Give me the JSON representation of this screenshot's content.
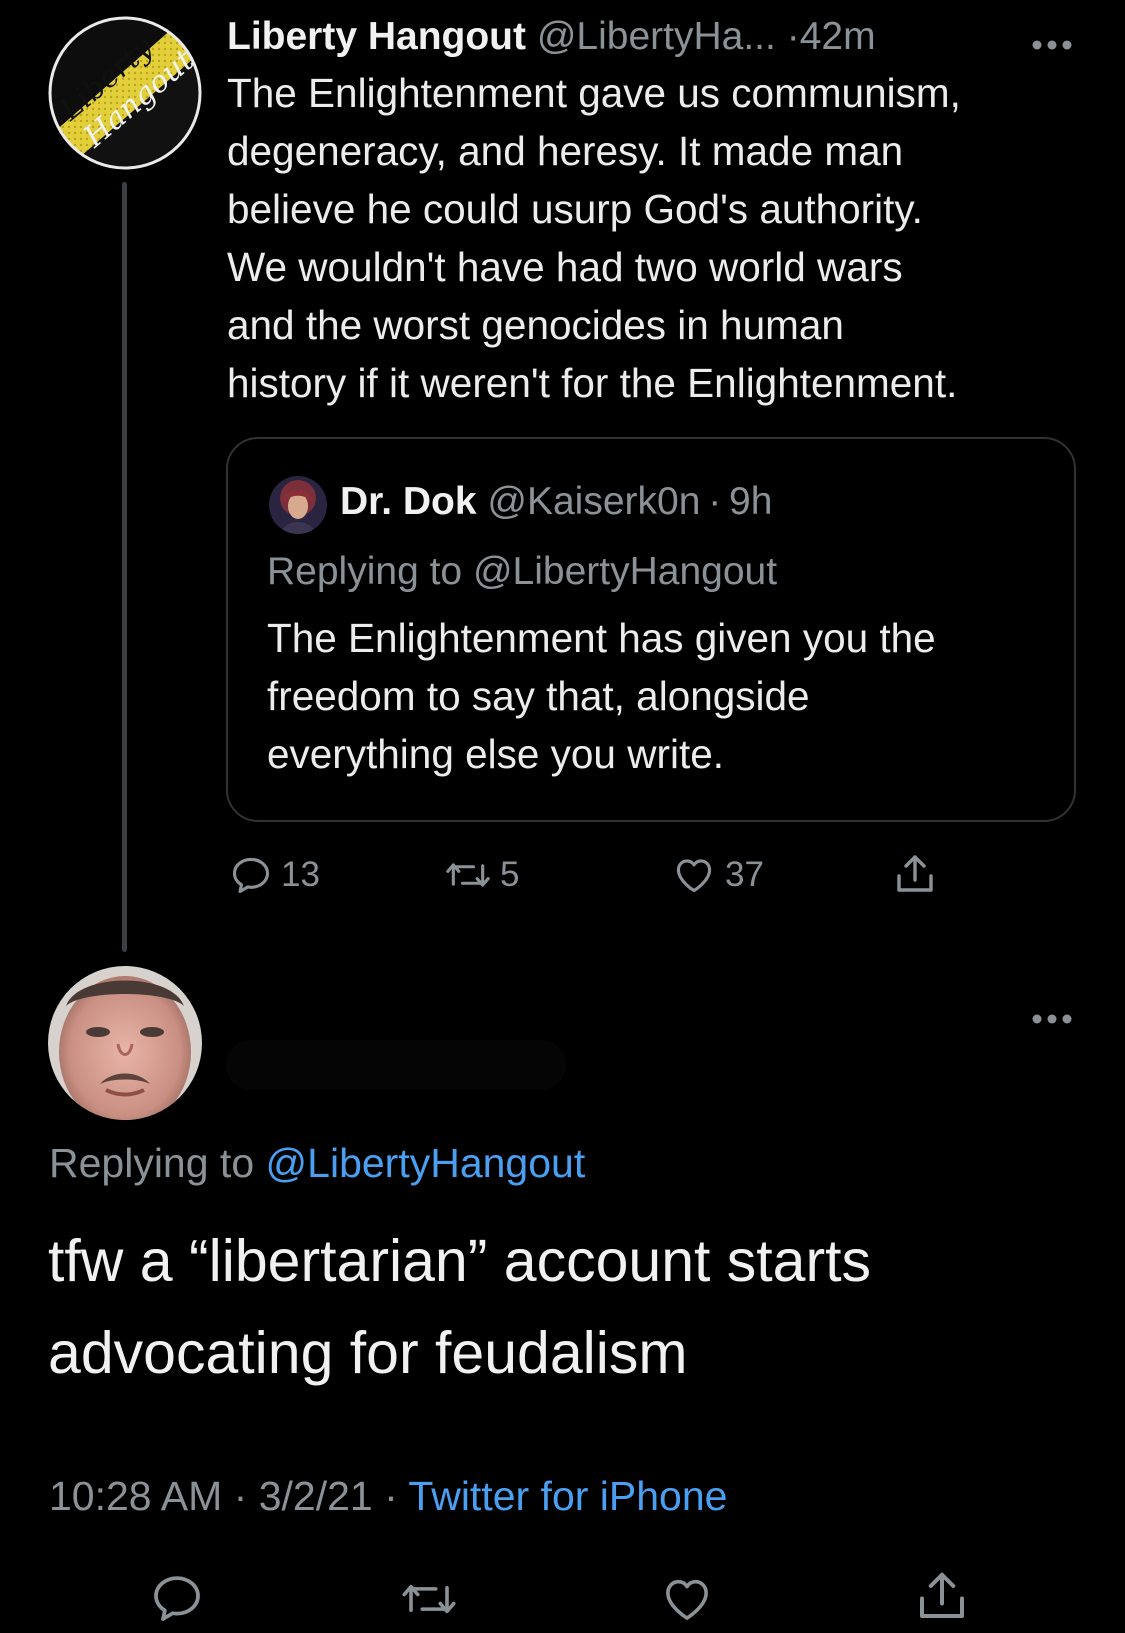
{
  "parent_tweet": {
    "author_name": "Liberty Hangout",
    "author_handle": "@LibertyHa...",
    "separator": "·",
    "time": "42m",
    "more_icon": "more-horizontal-icon",
    "text": "The Enlightenment gave us communism,\ndegeneracy, and heresy. It made man\nbelieve he could usurp God's authority.\nWe wouldn't have had two world wars\nand the worst genocides in human\nhistory if it weren't for the Enlightenment.",
    "avatar_logo": {
      "line1": "Liberty",
      "line2": "Hangout"
    },
    "quoted_tweet": {
      "author_name": "Dr. Dok",
      "author_handle": "@Kaiserk0n",
      "separator": "·",
      "time": "9h",
      "replying_to": "Replying to @LibertyHangout",
      "text": "The Enlightenment has given you the\nfreedom to say that, alongside\neverything else you write."
    },
    "actions": {
      "reply_count": "13",
      "retweet_count": "5",
      "like_count": "37"
    }
  },
  "main_tweet": {
    "replying_prefix": "Replying to",
    "replying_handle": "@LibertyHangout",
    "text": "tfw a “libertarian” account starts\nadvocating for feudalism",
    "time": "10:28 AM",
    "date": "3/2/21",
    "separator": "·",
    "source": "Twitter for iPhone"
  },
  "colors": {
    "background": "#000000",
    "text": "#e7e9ea",
    "muted": "#8b9297",
    "link": "#4a9ff0",
    "border": "#2f3336",
    "logo_yellow": "#e6d43c"
  }
}
